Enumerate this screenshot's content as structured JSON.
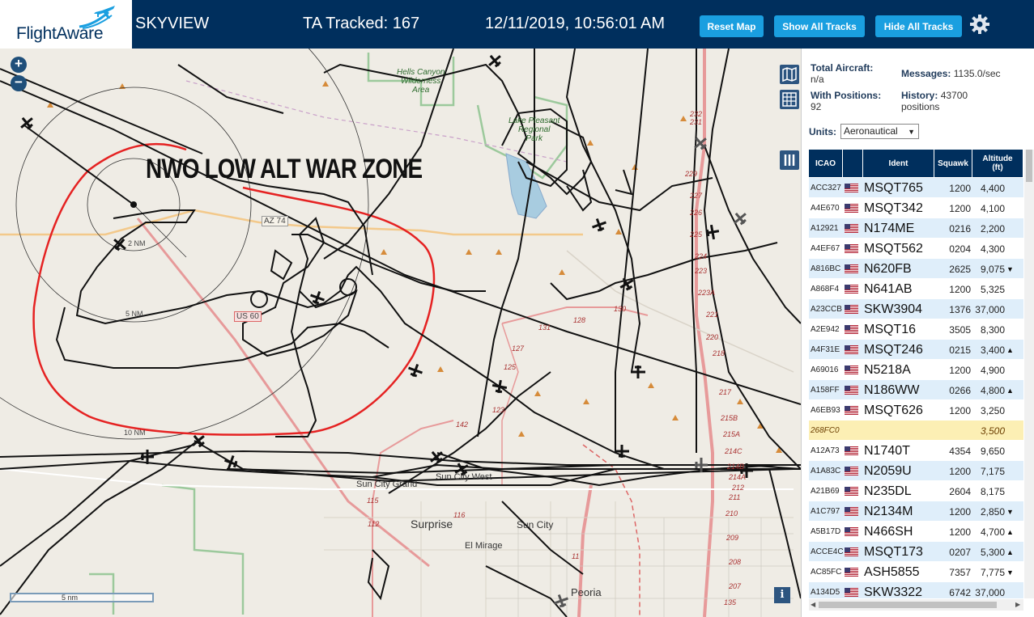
{
  "header": {
    "logo_text": "FlightAware",
    "app_name": "SKYVIEW",
    "ta_tracked": "TA Tracked: 167",
    "datetime": "12/11/2019, 10:56:01 AM",
    "buttons": {
      "reset": "Reset Map",
      "show_all": "Show All Tracks",
      "hide_all": "Hide All Tracks"
    },
    "settings_icon": "gear-icon",
    "accent_color": "#1a9fe0",
    "bar_color": "#002f5d"
  },
  "map": {
    "annotation": "NWO LOW ALT WAR ZONE",
    "labels": {
      "hells_canyon": "Hells Canyon\nWilderness\nArea",
      "lake_pleasant": "Lake Pleasant\nRegional\nPark",
      "az74": "AZ 74",
      "us60": "US 60",
      "ring_2nm": "2 NM",
      "ring_5nm": "5 NM",
      "ring_10nm": "10 NM",
      "sun_city_grand": "Sun City Grand",
      "sun_city_west": "Sun City West",
      "surprise": "Surprise",
      "sun_city": "Sun City",
      "el_mirage": "El Mirage",
      "peoria": "Peoria"
    },
    "route_numbers": [
      "232",
      "231",
      "229",
      "227",
      "226",
      "225",
      "224",
      "223",
      "223A",
      "221",
      "220",
      "218",
      "217",
      "215B",
      "215A",
      "214C",
      "214B",
      "214A",
      "212",
      "211",
      "210",
      "209",
      "208",
      "207",
      "135",
      "130",
      "131",
      "128",
      "127",
      "125",
      "123",
      "142",
      "116",
      "115",
      "112",
      "11"
    ],
    "scale": "5 nm",
    "zoom_in": "+",
    "zoom_out": "−",
    "info": "i"
  },
  "sidebar": {
    "total_aircraft_label": "Total Aircraft:",
    "total_aircraft_value": "n/a",
    "messages_label": "Messages:",
    "messages_value": "1135.0/sec",
    "with_positions_label": "With Positions:",
    "with_positions_value": "92",
    "history_label": "History:",
    "history_value": "43700",
    "history_unit": "positions",
    "units_label": "Units:",
    "units_value": "Aeronautical",
    "columns": [
      "ICAO",
      "",
      "Ident",
      "Squawk",
      "Altitude\n(ft)"
    ],
    "rows": [
      {
        "icao": "ACC327",
        "ident": "MSQT765",
        "squawk": "1200",
        "alt": "4,400",
        "trend": "",
        "style": "blue"
      },
      {
        "icao": "A4E670",
        "ident": "MSQT342",
        "squawk": "1200",
        "alt": "4,100",
        "trend": "",
        "style": "white"
      },
      {
        "icao": "A12921",
        "ident": "N174ME",
        "squawk": "0216",
        "alt": "2,200",
        "trend": "",
        "style": "blue"
      },
      {
        "icao": "A4EF67",
        "ident": "MSQT562",
        "squawk": "0204",
        "alt": "4,300",
        "trend": "",
        "style": "white"
      },
      {
        "icao": "A816BC",
        "ident": "N620FB",
        "squawk": "2625",
        "alt": "9,075",
        "trend": "▼",
        "style": "blue"
      },
      {
        "icao": "A868F4",
        "ident": "N641AB",
        "squawk": "1200",
        "alt": "5,325",
        "trend": "",
        "style": "white"
      },
      {
        "icao": "A23CCB",
        "ident": "SKW3904",
        "squawk": "1376",
        "alt": "37,000",
        "trend": "",
        "style": "blue"
      },
      {
        "icao": "A2E942",
        "ident": "MSQT16",
        "squawk": "3505",
        "alt": "8,300",
        "trend": "",
        "style": "white"
      },
      {
        "icao": "A4F31E",
        "ident": "MSQT246",
        "squawk": "0215",
        "alt": "3,400",
        "trend": "▲",
        "style": "blue"
      },
      {
        "icao": "A69016",
        "ident": "N5218A",
        "squawk": "1200",
        "alt": "4,900",
        "trend": "",
        "style": "white"
      },
      {
        "icao": "A158FF",
        "ident": "N186WW",
        "squawk": "0266",
        "alt": "4,800",
        "trend": "▲",
        "style": "blue"
      },
      {
        "icao": "A6EB93",
        "ident": "MSQT626",
        "squawk": "1200",
        "alt": "3,250",
        "trend": "",
        "style": "white"
      },
      {
        "icao": "268FC0",
        "ident": "",
        "squawk": "",
        "alt": "3,500",
        "trend": "",
        "style": "yellow"
      },
      {
        "icao": "A12A73",
        "ident": "N1740T",
        "squawk": "4354",
        "alt": "9,650",
        "trend": "",
        "style": "white"
      },
      {
        "icao": "A1A83C",
        "ident": "N2059U",
        "squawk": "1200",
        "alt": "7,175",
        "trend": "",
        "style": "blue"
      },
      {
        "icao": "A21B69",
        "ident": "N235DL",
        "squawk": "2604",
        "alt": "8,175",
        "trend": "",
        "style": "white"
      },
      {
        "icao": "A1C797",
        "ident": "N2134M",
        "squawk": "1200",
        "alt": "2,850",
        "trend": "▼",
        "style": "blue"
      },
      {
        "icao": "A5B17D",
        "ident": "N466SH",
        "squawk": "1200",
        "alt": "4,700",
        "trend": "▲",
        "style": "white"
      },
      {
        "icao": "ACCE4C",
        "ident": "MSQT173",
        "squawk": "0207",
        "alt": "5,300",
        "trend": "▲",
        "style": "blue"
      },
      {
        "icao": "AC85FC",
        "ident": "ASH5855",
        "squawk": "7357",
        "alt": "7,775",
        "trend": "▼",
        "style": "white"
      },
      {
        "icao": "A134D5",
        "ident": "SKW3322",
        "squawk": "6742",
        "alt": "37,000",
        "trend": "",
        "style": "blue"
      }
    ]
  }
}
